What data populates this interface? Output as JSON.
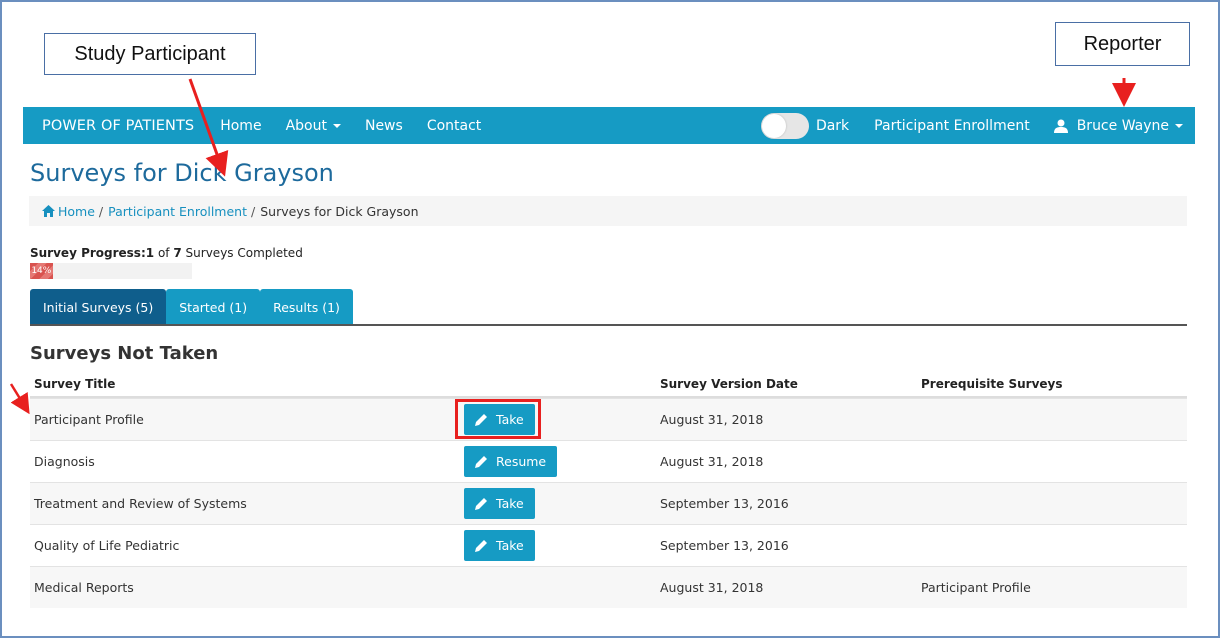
{
  "callouts": {
    "study_participant": "Study Participant",
    "reporter": "Reporter"
  },
  "navbar": {
    "brand": "POWER OF PATIENTS",
    "home": "Home",
    "about": "About",
    "news": "News",
    "contact": "Contact",
    "dark_label": "Dark",
    "enrollment": "Participant Enrollment",
    "user_name": "Bruce Wayne"
  },
  "page": {
    "title": "Surveys for Dick Grayson"
  },
  "breadcrumb": {
    "home": "Home",
    "enrollment": "Participant Enrollment",
    "current": "Surveys for Dick Grayson",
    "separator": "/"
  },
  "progress": {
    "label": "Survey Progress:",
    "completed": "1",
    "of": "of",
    "total": "7",
    "suffix": "Surveys Completed",
    "percent_text": "14%",
    "percent": 14
  },
  "tabs": [
    {
      "label": "Initial Surveys (5)"
    },
    {
      "label": "Started (1)"
    },
    {
      "label": "Results (1)"
    }
  ],
  "section": {
    "title": "Surveys Not Taken"
  },
  "table": {
    "headers": [
      "Survey Title",
      "",
      "Survey Version Date",
      "Prerequisite Surveys"
    ],
    "rows": [
      {
        "title": "Participant Profile",
        "action": "Take",
        "date": "August 31, 2018",
        "prereq": ""
      },
      {
        "title": "Diagnosis",
        "action": "Resume",
        "date": "August 31, 2018",
        "prereq": ""
      },
      {
        "title": "Treatment and Review of Systems",
        "action": "Take",
        "date": "September 13, 2016",
        "prereq": ""
      },
      {
        "title": "Quality of Life Pediatric",
        "action": "Take",
        "date": "September 13, 2016",
        "prereq": ""
      },
      {
        "title": "Medical Reports",
        "action": "",
        "date": "August 31, 2018",
        "prereq": "Participant Profile"
      }
    ]
  },
  "colors": {
    "navbar": "#169bc4",
    "active_tab": "#0f5e8c",
    "title": "#1d6a9c",
    "progress": "#d9534f",
    "annotation": "#e8201f"
  }
}
